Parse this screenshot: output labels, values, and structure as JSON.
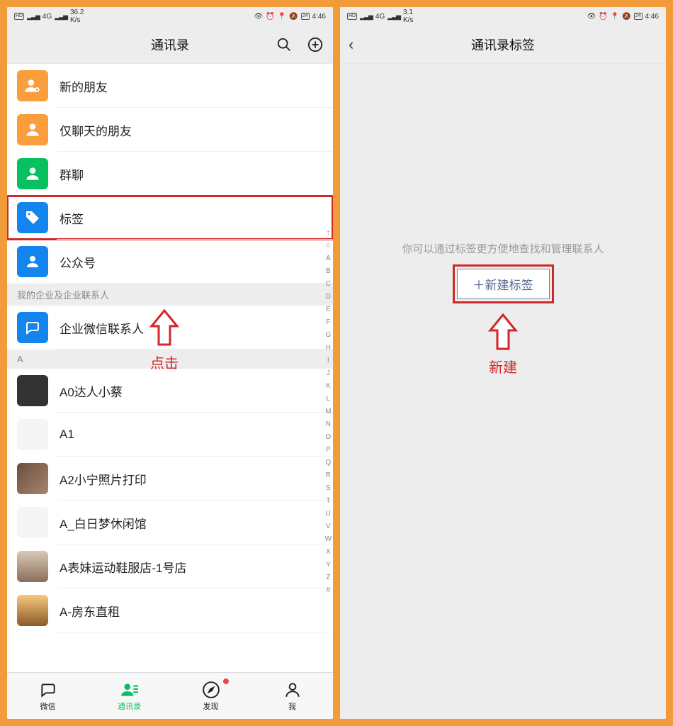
{
  "statusbar_left": {
    "hd": "HD",
    "net": "4G",
    "speed1": "36.2",
    "speed2": "3.1",
    "unit": "K/s"
  },
  "statusbar_right": {
    "battery": "24",
    "time": "4:46"
  },
  "screen1": {
    "title": "通讯录",
    "items": [
      {
        "label": "新的朋友",
        "color": "orange",
        "icon": "person-add"
      },
      {
        "label": "仅聊天的朋友",
        "color": "orange",
        "icon": "chat-person"
      },
      {
        "label": "群聊",
        "color": "green",
        "icon": "group"
      },
      {
        "label": "标签",
        "color": "blue",
        "icon": "tag",
        "highlight": true
      },
      {
        "label": "公众号",
        "color": "blue2",
        "icon": "official"
      }
    ],
    "section_enterprise": "我的企业及企业联系人",
    "enterprise_item": "企业微信联系人",
    "section_A": "A",
    "contacts": [
      {
        "name": "A0达人小蔡",
        "avatar": "dark"
      },
      {
        "name": "A1",
        "avatar": "white"
      },
      {
        "name": "A2小宁照片打印",
        "avatar": "photo"
      },
      {
        "name": "A_白日梦休闲馆",
        "avatar": "white"
      },
      {
        "name": "A表妹运动鞋服店-1号店",
        "avatar": "girl"
      },
      {
        "name": "A-房东直租",
        "avatar": "sky"
      }
    ],
    "index": [
      "↑",
      "☆",
      "A",
      "B",
      "C",
      "D",
      "E",
      "F",
      "G",
      "H",
      "I",
      "J",
      "K",
      "L",
      "M",
      "N",
      "O",
      "P",
      "Q",
      "R",
      "S",
      "T",
      "U",
      "V",
      "W",
      "X",
      "Y",
      "Z",
      "#"
    ],
    "annotation": "点击",
    "tabs": [
      {
        "label": "微信",
        "icon": "chat"
      },
      {
        "label": "通讯录",
        "icon": "contacts",
        "active": true
      },
      {
        "label": "发现",
        "icon": "discover",
        "dot": true
      },
      {
        "label": "我",
        "icon": "me"
      }
    ]
  },
  "screen2": {
    "title": "通讯录标签",
    "tip": "你可以通过标签更方便地查找和管理联系人",
    "button": "＋新建标签",
    "annotation": "新建"
  }
}
